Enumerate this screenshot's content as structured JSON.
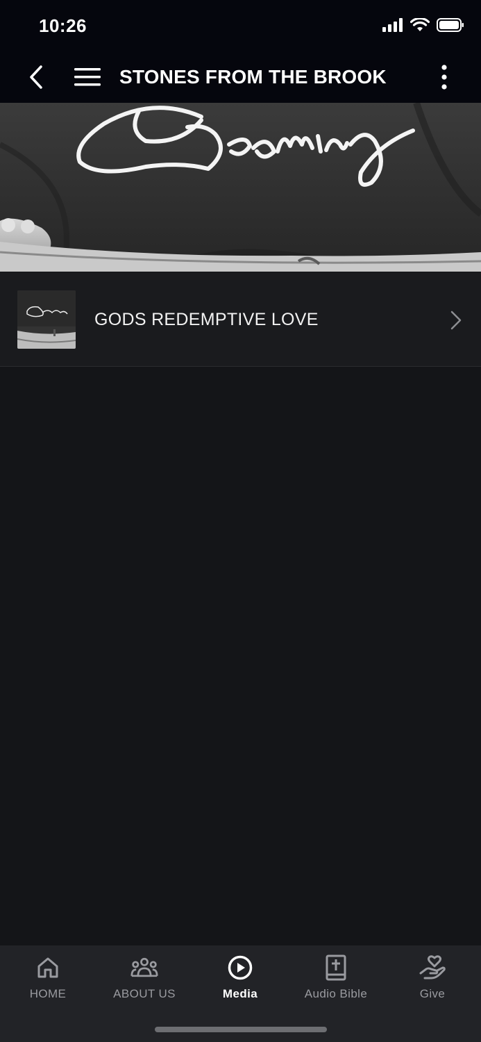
{
  "status_bar": {
    "time": "10:26"
  },
  "header": {
    "title": "STONES FROM THE BROOK"
  },
  "hero": {
    "text": "Becoming"
  },
  "list": [
    {
      "label": "GODS REDEMPTIVE LOVE"
    }
  ],
  "tab_bar": {
    "tabs": [
      {
        "label": "HOME",
        "icon": "home-icon",
        "active": false
      },
      {
        "label": "ABOUT US",
        "icon": "people-icon",
        "active": false
      },
      {
        "label": "Media",
        "icon": "play-circle-icon",
        "active": true
      },
      {
        "label": "Audio Bible",
        "icon": "bible-icon",
        "active": false
      },
      {
        "label": "Give",
        "icon": "give-heart-icon",
        "active": false
      }
    ]
  },
  "colors": {
    "background": "#141518",
    "header": "#05060d",
    "tab_bar": "#222327",
    "inactive_tab": "#9a9ba0"
  }
}
